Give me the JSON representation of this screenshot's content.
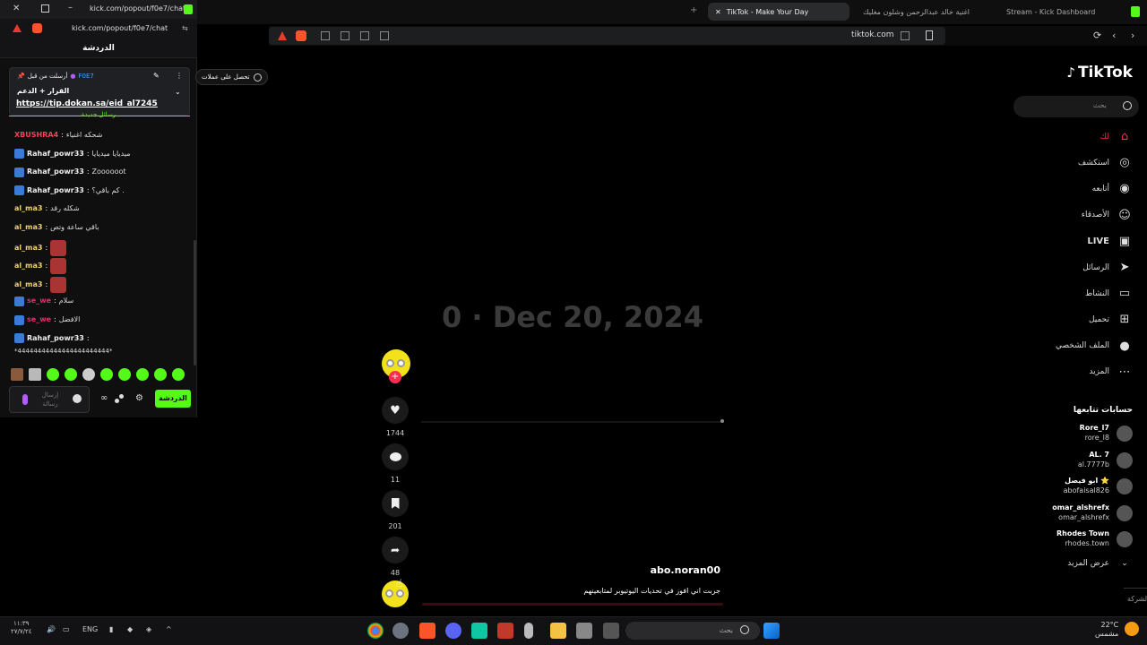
{
  "browser": {
    "tabs": [
      {
        "label": "TikTok - Make Your Day",
        "active": true
      },
      {
        "label": "اغنية خالد عبدالرحمن وشلون مغليك",
        "active": false
      },
      {
        "label": "Stream - Kick Dashboard",
        "active": false
      }
    ],
    "url": "tiktok.com"
  },
  "chat_window": {
    "title": "kick.com/popout/f0e7/chat...",
    "address": "kick.com/popout/f0e7/chat",
    "header": "الدردشة",
    "pinned": {
      "sender_prefix": "أرسلت من قبل",
      "sender": "F0E7",
      "title": "القرار + الدعم",
      "link": "https://tip.dokan.sa/eid_al7245",
      "new_messages": "رسائل جديدة"
    },
    "messages": [
      {
        "user": "XBUSHRA4",
        "text": "شحكه اغنياء",
        "color": "pink",
        "badge": false,
        "emote": false
      },
      {
        "user": "Rahaf_powr33",
        "text": "ميديايا ميديايا",
        "color": "white",
        "badge": true,
        "emote": false
      },
      {
        "user": "Rahaf_powr33",
        "text": "Zoooooot",
        "color": "white",
        "badge": true,
        "emote": false
      },
      {
        "user": "Rahaf_powr33",
        "text": "كم باقي؟ .",
        "color": "white",
        "badge": true,
        "emote": false
      },
      {
        "user": "al_ma3",
        "text": "شكله رقد",
        "color": "yellow",
        "badge": false,
        "emote": false
      },
      {
        "user": "al_ma3",
        "text": "باقي ساعة وتص",
        "color": "yellow",
        "badge": false,
        "emote": false
      },
      {
        "user": "al_ma3",
        "text": "",
        "color": "yellow",
        "badge": false,
        "emote": true
      },
      {
        "user": "al_ma3",
        "text": "",
        "color": "yellow",
        "badge": false,
        "emote": true
      },
      {
        "user": "al_ma3",
        "text": "",
        "color": "yellow",
        "badge": false,
        "emote": true
      },
      {
        "user": "se_we",
        "text": "سلام",
        "color": "magenta",
        "badge": true,
        "emote": false
      },
      {
        "user": "se_we",
        "text": "الافضل",
        "color": "magenta",
        "badge": true,
        "emote": false
      },
      {
        "user": "Rahaf_powr33",
        "text": "",
        "color": "white",
        "badge": true,
        "emote": false
      }
    ],
    "continued_text": "*44444444444444444444444*",
    "input_placeholder": "إرسال رسالة",
    "send_label": "الدردشة"
  },
  "overlay_pill": "تحصل على عملات",
  "video": {
    "date_text": "0 · Dec 20, 2024",
    "author": "abo.noran00",
    "caption": "جربت اني افوز في تحديات اليوتيوبر لمتابعينهم",
    "likes": "1744",
    "comments": "11",
    "saves": "201",
    "shares": "48"
  },
  "tiktok": {
    "logo": "TikTok",
    "search_placeholder": "بحث",
    "nav": [
      {
        "label": "لك",
        "icon": "home-icon",
        "active": true
      },
      {
        "label": "استكشف",
        "icon": "explore-icon",
        "active": false
      },
      {
        "label": "أتابعه",
        "icon": "following-icon",
        "active": false
      },
      {
        "label": "الأصدقاء",
        "icon": "friends-icon",
        "active": false
      },
      {
        "label": "LIVE",
        "icon": "live-icon",
        "active": false
      },
      {
        "label": "الرسائل",
        "icon": "messages-icon",
        "active": false
      },
      {
        "label": "النشاط",
        "icon": "activity-icon",
        "active": false
      },
      {
        "label": "تحميل",
        "icon": "upload-icon",
        "active": false
      },
      {
        "label": "الملف الشخصي",
        "icon": "profile-icon",
        "active": false
      },
      {
        "label": "المزيد",
        "icon": "more-icon",
        "active": false
      }
    ],
    "following_title": "حسابات تتابعها",
    "following": [
      {
        "name": "Rore_l7",
        "handle": "rore_l8"
      },
      {
        "name": "AL. 7",
        "handle": "al.7777b"
      },
      {
        "name": "ابو فيصل ⭐",
        "handle": "abofaisal826"
      },
      {
        "name": "omar_alshrefx",
        "handle": "omar_alshrefx"
      },
      {
        "name": "Rhodes Town",
        "handle": "rhodes.town"
      }
    ],
    "show_more": "عرض المزيد",
    "company": "الشركة"
  },
  "taskbar": {
    "search_placeholder": "بحث",
    "lang": "ENG",
    "time": "١١:٣٩",
    "date": "٢٧/٧/٢٤",
    "temperature": "22°C",
    "weather": "مشمس"
  }
}
